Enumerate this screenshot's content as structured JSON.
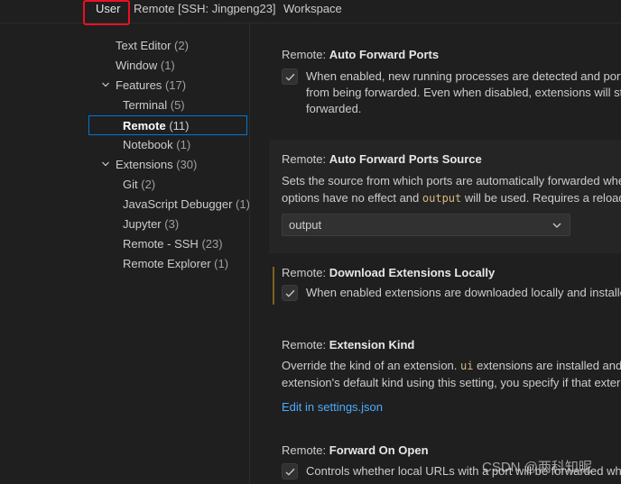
{
  "tabs": [
    {
      "label": "User"
    },
    {
      "label": "Remote [SSH: Jingpeng23]"
    },
    {
      "label": "Workspace"
    }
  ],
  "toc": {
    "text_editor": {
      "label": "Text Editor",
      "count": "(2)"
    },
    "window": {
      "label": "Window",
      "count": "(1)"
    },
    "features": {
      "label": "Features",
      "count": "(17)"
    },
    "terminal": {
      "label": "Terminal",
      "count": "(5)"
    },
    "remote": {
      "label": "Remote",
      "count": "(11)"
    },
    "notebook": {
      "label": "Notebook",
      "count": "(1)"
    },
    "extensions": {
      "label": "Extensions",
      "count": "(30)"
    },
    "git": {
      "label": "Git",
      "count": "(2)"
    },
    "js_debugger": {
      "label": "JavaScript Debugger",
      "count": "(1)"
    },
    "jupyter": {
      "label": "Jupyter",
      "count": "(3)"
    },
    "remote_ssh": {
      "label": "Remote - SSH",
      "count": "(23)"
    },
    "remote_explorer": {
      "label": "Remote Explorer",
      "count": "(1)"
    }
  },
  "settings": {
    "auto_forward": {
      "prefix": "Remote: ",
      "name": "Auto Forward Ports",
      "desc_1": "When enabled, new running processes are detected and port",
      "desc_2": "from being forwarded. Even when disabled, extensions will st",
      "desc_3": "forwarded."
    },
    "auto_forward_source": {
      "prefix": "Remote: ",
      "name": "Auto Forward Ports Source",
      "desc_1": "Sets the source from which ports are automatically forwarded whe",
      "desc_2a": "options have no effect and ",
      "desc_2code": "output",
      "desc_2b": " will be used. Requires a reload",
      "select_value": "output"
    },
    "download_locally": {
      "prefix": "Remote: ",
      "name": "Download Extensions Locally",
      "desc": "When enabled extensions are downloaded locally and installe"
    },
    "extension_kind": {
      "prefix": "Remote: ",
      "name": "Extension Kind",
      "desc_1a": "Override the kind of an extension. ",
      "desc_1code": "ui",
      "desc_1b": " extensions are installed and",
      "desc_2": "extension's default kind using this setting, you specify if that exter",
      "link": "Edit in settings.json"
    },
    "forward_on_open": {
      "prefix": "Remote: ",
      "name": "Forward On Open",
      "desc": "Controls whether local URLs with a port will be forwarded wh"
    }
  },
  "watermark": "CSDN @两科知昵"
}
